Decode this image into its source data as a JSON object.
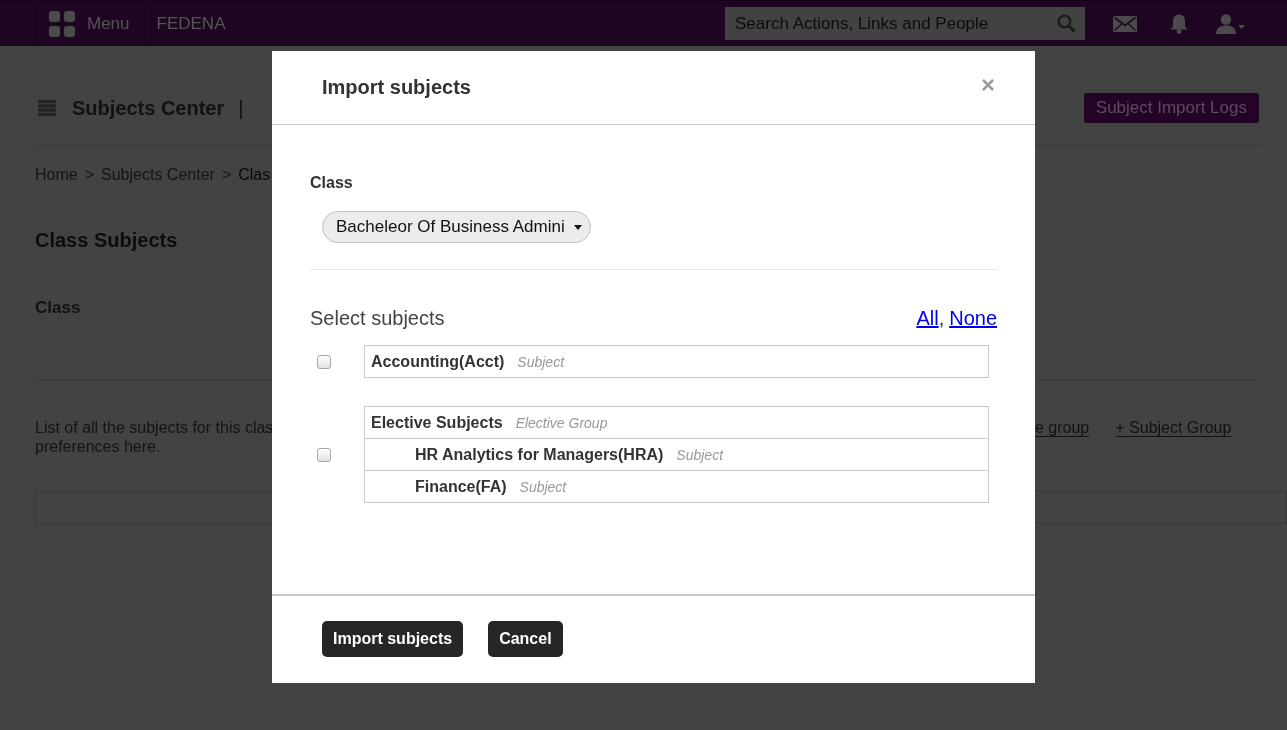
{
  "top_bar": {
    "menu": "Menu",
    "brand": "FEDENA",
    "search": {
      "placeholder": "Search Actions, Links and People"
    }
  },
  "page": {
    "title": "Subjects Center",
    "title_separator": "|",
    "header_button": "Subject Import Logs",
    "breadcrumb": [
      {
        "label": "Home",
        "current": false,
        "separator": ">"
      },
      {
        "label": "Subjects Center",
        "current": false,
        "separator": ">"
      },
      {
        "label": "Clas",
        "current": true
      }
    ],
    "section_title": "Class Subjects",
    "class_label": "Class",
    "description": [
      "List of all the subjects for this clas",
      "preferences here."
    ],
    "links": [
      "e group",
      "+ Subject Group"
    ]
  },
  "modal": {
    "title": "Import subjects",
    "close": "×",
    "class_label": "Class",
    "class_select": {
      "value": "Bacheleor Of Business Admini"
    },
    "select_label": "Select subjects",
    "select_all": "All",
    "list_separator": ",",
    "select_none": "None",
    "subjects": [
      {
        "kind": "subject",
        "checked": false,
        "name": "Accounting(Acct)",
        "type": "Subject"
      },
      {
        "kind": "group",
        "checked": false,
        "name": "Elective Subjects",
        "type": "Elective Group",
        "children": [
          {
            "name": "HR Analytics for Managers(HRA)",
            "type": "Subject"
          },
          {
            "name": "Finance(FA)",
            "type": "Subject"
          }
        ]
      }
    ],
    "buttons": [
      "Import subjects",
      "Cancel"
    ]
  }
}
